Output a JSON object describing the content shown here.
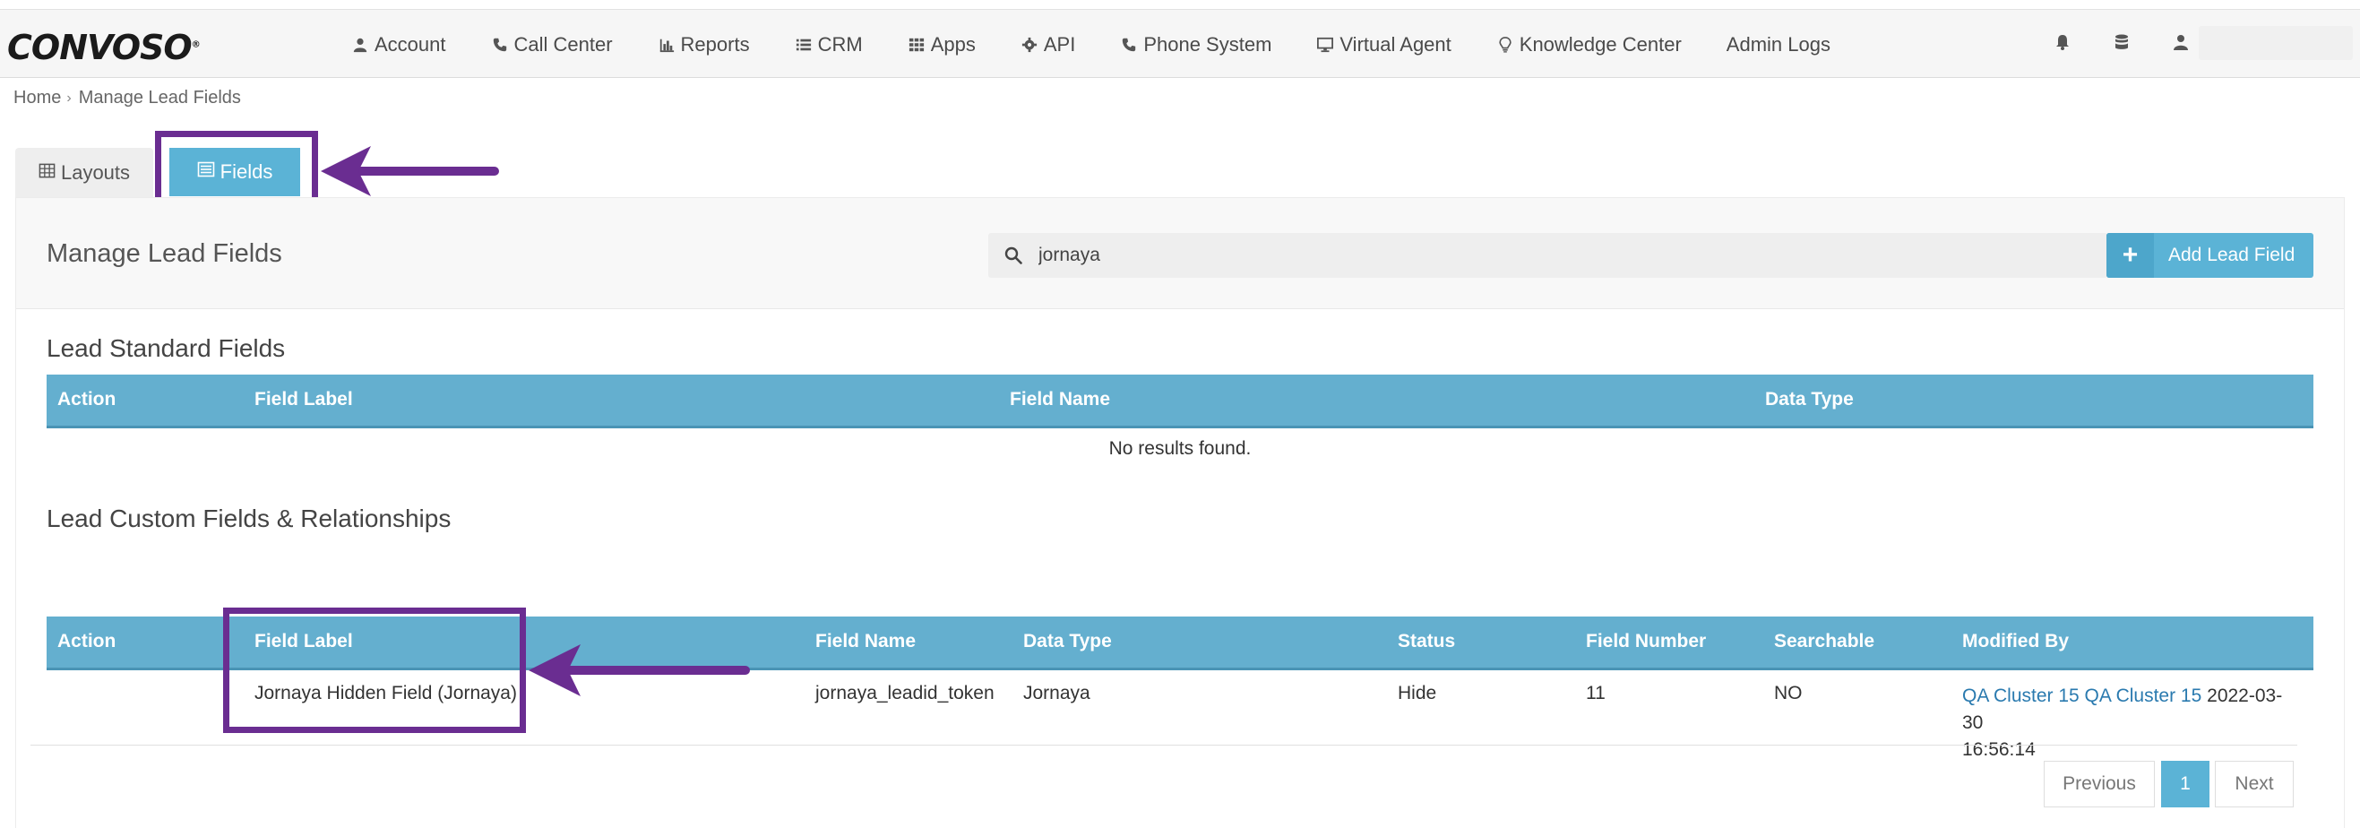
{
  "app": {
    "logo": "CONVOSO",
    "logo_mark": "®"
  },
  "nav": {
    "items": [
      {
        "label": "Account",
        "icon": "user-icon"
      },
      {
        "label": "Call Center",
        "icon": "phone-icon"
      },
      {
        "label": "Reports",
        "icon": "bar-chart-icon"
      },
      {
        "label": "CRM",
        "icon": "list-icon"
      },
      {
        "label": "Apps",
        "icon": "grid-icon"
      },
      {
        "label": "API",
        "icon": "gear-icon"
      },
      {
        "label": "Phone System",
        "icon": "phone-icon"
      },
      {
        "label": "Virtual Agent",
        "icon": "monitor-icon"
      },
      {
        "label": "Knowledge Center",
        "icon": "lightbulb-icon"
      },
      {
        "label": "Admin Logs",
        "icon": ""
      }
    ],
    "right_icons": [
      "bell-icon",
      "database-icon",
      "user-icon"
    ]
  },
  "breadcrumb": {
    "home": "Home",
    "separator": "›",
    "current": "Manage Lead Fields"
  },
  "tabs": [
    {
      "label": "Layouts",
      "icon": "table-icon",
      "active": false
    },
    {
      "label": "Fields",
      "icon": "list-alt-icon",
      "active": true
    }
  ],
  "panel": {
    "title": "Manage Lead Fields",
    "search_value": "jornaya",
    "add_button": "Add Lead Field",
    "add_button_icon": "+"
  },
  "standard_fields": {
    "title": "Lead Standard Fields",
    "columns": [
      "Action",
      "Field Label",
      "Field Name",
      "Data Type"
    ],
    "empty_text": "No results found."
  },
  "custom_fields": {
    "title": "Lead Custom Fields & Relationships",
    "columns": [
      "Action",
      "Field Label",
      "Field Name",
      "Data Type",
      "Status",
      "Field Number",
      "Searchable",
      "Modified By"
    ],
    "rows": [
      {
        "action": "",
        "field_label": "Jornaya Hidden Field (Jornaya)",
        "field_name": "jornaya_leadid_token",
        "data_type": "Jornaya",
        "status": "Hide",
        "field_number": "11",
        "searchable": "NO",
        "modified_by_link": "QA Cluster 15 QA Cluster 15",
        "modified_date": "2022-03-30",
        "modified_time": "16:56:14"
      }
    ]
  },
  "pagination": {
    "previous": "Previous",
    "current": "1",
    "next": "Next"
  },
  "colors": {
    "accent": "#5bb3d6",
    "table_header": "#64afcf",
    "highlight": "#6a2d91",
    "link": "#2a7aaf"
  }
}
